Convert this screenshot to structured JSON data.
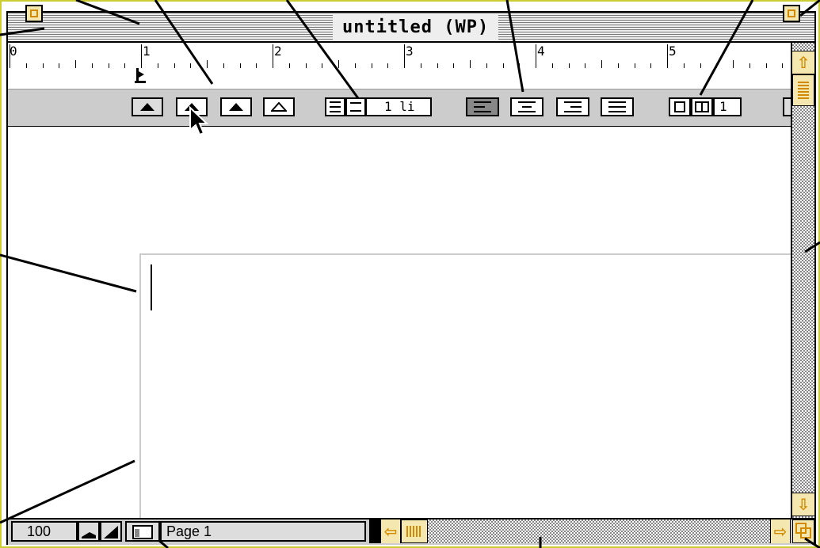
{
  "window": {
    "title": "untitled (WP)"
  },
  "ruler": {
    "numbers": [
      "0",
      "1",
      "2",
      "3",
      "4",
      "5"
    ]
  },
  "formatbar": {
    "line_spacing_value": "1 li",
    "columns_value": "1"
  },
  "statusbar": {
    "zoom_value": "100",
    "page_label": "Page 1"
  },
  "colors": {
    "accent": "#d28b00",
    "accent_bg": "#f5e7b0",
    "toolbar_gray": "#cccccc"
  }
}
